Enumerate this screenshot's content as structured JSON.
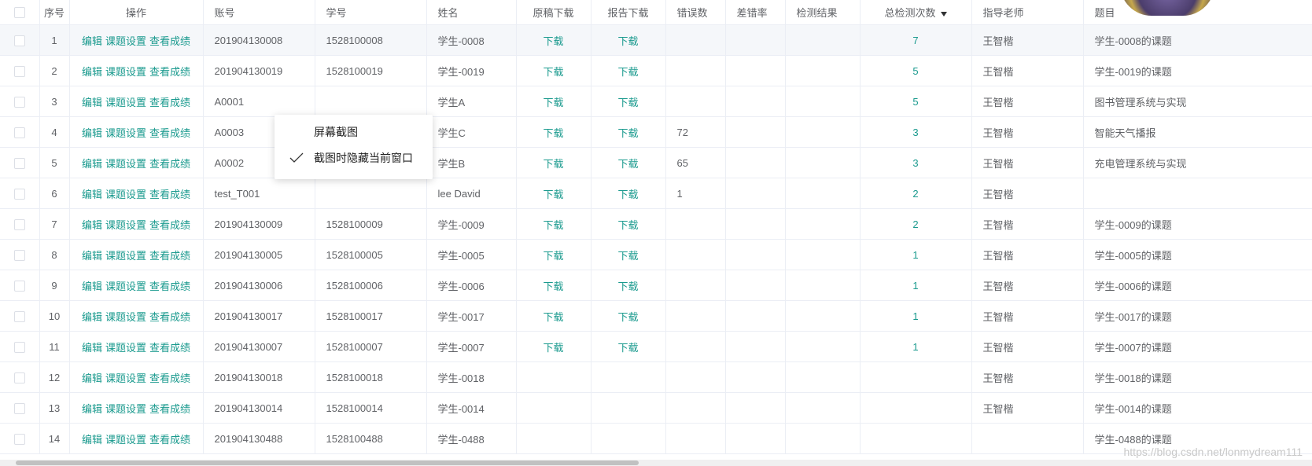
{
  "columns": [
    "",
    "序号",
    "操作",
    "账号",
    "学号",
    "姓名",
    "原稿下载",
    "报告下载",
    "错误数",
    "差错率",
    "检测结果",
    "总检测次数",
    "指导老师",
    "题目"
  ],
  "ops": {
    "edit": "编辑",
    "topic": "课题设置",
    "score": "查看成绩"
  },
  "rows": [
    {
      "no": "1",
      "account": "201904130008",
      "sid": "1528100008",
      "name": "学生-0008",
      "orig": "下载",
      "report": "下载",
      "errors": "",
      "rate": "",
      "result": "",
      "count": "7",
      "teacher": "王智楷",
      "topic": "学生-0008的课题"
    },
    {
      "no": "2",
      "account": "201904130019",
      "sid": "1528100019",
      "name": "学生-0019",
      "orig": "下载",
      "report": "下载",
      "errors": "",
      "rate": "",
      "result": "",
      "count": "5",
      "teacher": "王智楷",
      "topic": "学生-0019的课题"
    },
    {
      "no": "3",
      "account": "A0001",
      "sid": "",
      "name": "学生A",
      "orig": "下载",
      "report": "下载",
      "errors": "",
      "rate": "",
      "result": "",
      "count": "5",
      "teacher": "王智楷",
      "topic": "图书管理系统与实现"
    },
    {
      "no": "4",
      "account": "A0003",
      "sid": "",
      "name": "学生C",
      "orig": "下载",
      "report": "下载",
      "errors": "72",
      "rate": "",
      "result": "",
      "count": "3",
      "teacher": "王智楷",
      "topic": "智能天气播报"
    },
    {
      "no": "5",
      "account": "A0002",
      "sid": "",
      "name": "学生B",
      "orig": "下载",
      "report": "下载",
      "errors": "65",
      "rate": "",
      "result": "",
      "count": "3",
      "teacher": "王智楷",
      "topic": "充电管理系统与实现"
    },
    {
      "no": "6",
      "account": "test_T001",
      "sid": "",
      "name": "lee David",
      "orig": "下载",
      "report": "下载",
      "errors": "1",
      "rate": "",
      "result": "",
      "count": "2",
      "teacher": "王智楷",
      "topic": ""
    },
    {
      "no": "7",
      "account": "201904130009",
      "sid": "1528100009",
      "name": "学生-0009",
      "orig": "下载",
      "report": "下载",
      "errors": "",
      "rate": "",
      "result": "",
      "count": "2",
      "teacher": "王智楷",
      "topic": "学生-0009的课题"
    },
    {
      "no": "8",
      "account": "201904130005",
      "sid": "1528100005",
      "name": "学生-0005",
      "orig": "下载",
      "report": "下载",
      "errors": "",
      "rate": "",
      "result": "",
      "count": "1",
      "teacher": "王智楷",
      "topic": "学生-0005的课题"
    },
    {
      "no": "9",
      "account": "201904130006",
      "sid": "1528100006",
      "name": "学生-0006",
      "orig": "下载",
      "report": "下载",
      "errors": "",
      "rate": "",
      "result": "",
      "count": "1",
      "teacher": "王智楷",
      "topic": "学生-0006的课题"
    },
    {
      "no": "10",
      "account": "201904130017",
      "sid": "1528100017",
      "name": "学生-0017",
      "orig": "下载",
      "report": "下载",
      "errors": "",
      "rate": "",
      "result": "",
      "count": "1",
      "teacher": "王智楷",
      "topic": "学生-0017的课题"
    },
    {
      "no": "11",
      "account": "201904130007",
      "sid": "1528100007",
      "name": "学生-0007",
      "orig": "下载",
      "report": "下载",
      "errors": "",
      "rate": "",
      "result": "",
      "count": "1",
      "teacher": "王智楷",
      "topic": "学生-0007的课题"
    },
    {
      "no": "12",
      "account": "201904130018",
      "sid": "1528100018",
      "name": "学生-0018",
      "orig": "",
      "report": "",
      "errors": "",
      "rate": "",
      "result": "",
      "count": "",
      "teacher": "王智楷",
      "topic": "学生-0018的课题"
    },
    {
      "no": "13",
      "account": "201904130014",
      "sid": "1528100014",
      "name": "学生-0014",
      "orig": "",
      "report": "",
      "errors": "",
      "rate": "",
      "result": "",
      "count": "",
      "teacher": "王智楷",
      "topic": "学生-0014的课题"
    },
    {
      "no": "14",
      "account": "201904130488",
      "sid": "1528100488",
      "name": "学生-0488",
      "orig": "",
      "report": "",
      "errors": "",
      "rate": "",
      "result": "",
      "count": "",
      "teacher": "",
      "topic": "学生-0488的课题"
    }
  ],
  "context_menu": {
    "items": [
      "屏幕截图",
      "截图时隐藏当前窗口"
    ],
    "checked_item": "截图时隐藏当前窗口"
  },
  "sort_icon": "sort-down-icon",
  "watermark": "https://blog.csdn.net/lonmydream111",
  "colors": {
    "link": "#1a9a8e",
    "border": "#ebeef5",
    "text": "#606266",
    "highlight_row": "#f5f7fa"
  }
}
